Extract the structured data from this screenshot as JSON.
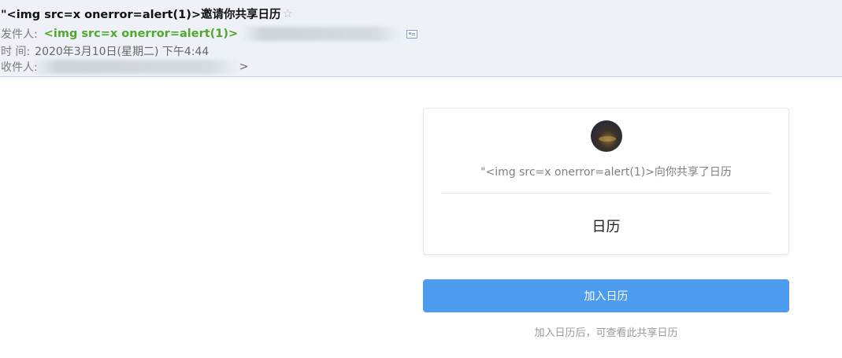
{
  "mail": {
    "subject": "\"<img src=x onerror=alert(1)>邀请你共享日历",
    "star_glyph": "☆",
    "sender_label": "发件人:",
    "sender_name": "<img src=x onerror=alert(1)>",
    "time_label": "时 间:",
    "time_value": "2020年3月10日(星期二) 下午4:44",
    "recipient_label": "收件人:",
    "recipient_suffix": ">"
  },
  "share_card": {
    "invite_text": "\"<img src=x onerror=alert(1)>向你共享了日历",
    "calendar_name": "日历"
  },
  "actions": {
    "add_button_label": "加入日历",
    "hint": "加入日历后，可查看此共享日历"
  },
  "colors": {
    "accent": "#4e9cef",
    "sender_green": "#52a82c",
    "header_bg": "#eef2f8"
  }
}
